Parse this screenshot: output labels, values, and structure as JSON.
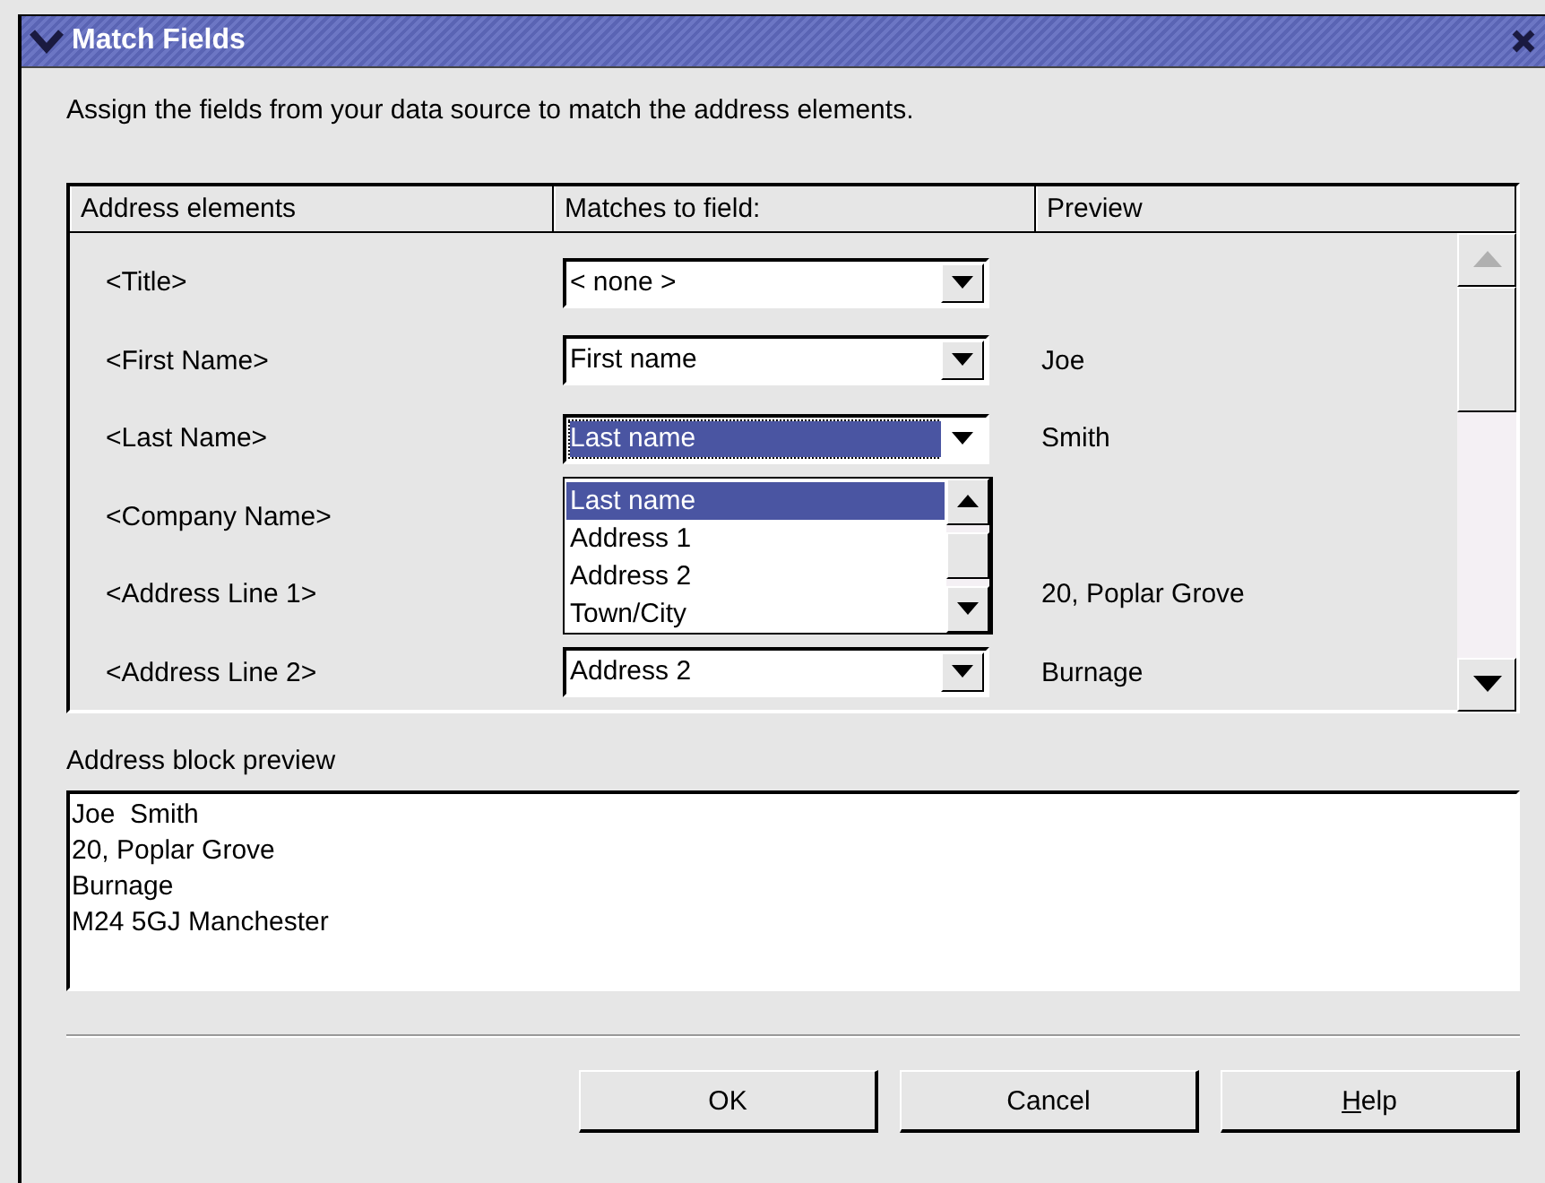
{
  "window": {
    "title": "Match Fields"
  },
  "instruction": "Assign the fields from your data source to match the address elements.",
  "table": {
    "columns": [
      "Address elements",
      "Matches to field:",
      "Preview"
    ],
    "rows": [
      {
        "element": "<Title>",
        "field": "< none >",
        "focused": false,
        "preview": ""
      },
      {
        "element": "<First Name>",
        "field": "First name",
        "focused": false,
        "preview": "Joe"
      },
      {
        "element": "<Last Name>",
        "field": "Last name",
        "focused": true,
        "preview": "Smith"
      },
      {
        "element": "<Company Name>",
        "preview": ""
      },
      {
        "element": "<Address Line 1>",
        "preview": "20, Poplar Grove"
      },
      {
        "element": "<Address Line 2>",
        "field": "Address 2",
        "focused": false,
        "preview": "Burnage"
      }
    ]
  },
  "dropdown": {
    "items": [
      {
        "label": "Last name",
        "selected": true
      },
      {
        "label": "Address 1",
        "selected": false
      },
      {
        "label": "Address 2",
        "selected": false
      },
      {
        "label": "Town/City",
        "selected": false
      }
    ]
  },
  "preview_label": "Address block preview",
  "preview_lines": [
    "Joe  Smith",
    "20, Poplar Grove",
    "Burnage",
    "M24 5GJ Manchester"
  ],
  "buttons": [
    {
      "label": "OK"
    },
    {
      "label": "Cancel"
    },
    {
      "label": "Help",
      "mnemonic": true
    }
  ]
}
